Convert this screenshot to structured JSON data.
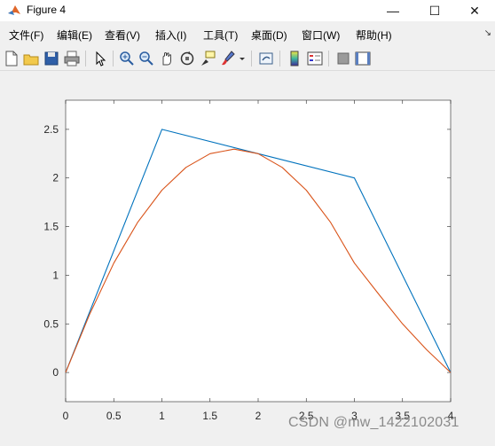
{
  "window": {
    "title": "Figure 4",
    "controls": {
      "minimize": "—",
      "maximize": "☐",
      "close": "✕"
    }
  },
  "menu": {
    "items": [
      "文件(F)",
      "编辑(E)",
      "查看(V)",
      "插入(I)",
      "工具(T)",
      "桌面(D)",
      "窗口(W)",
      "帮助(H)"
    ],
    "overflow_arrow": "↘"
  },
  "toolbar": {
    "buttons": [
      "new-figure-icon",
      "open-icon",
      "save-icon",
      "print-icon",
      "pointer-icon",
      "zoom-in-icon",
      "zoom-out-icon",
      "pan-icon",
      "rotate-3d-icon",
      "data-cursor-icon",
      "brush-icon",
      "brush-dropdown-icon",
      "link-plot-icon",
      "colorbar-icon",
      "legend-icon",
      "hide-plot-tools-icon",
      "show-plot-tools-icon"
    ]
  },
  "chart_data": {
    "type": "line",
    "xlim": [
      0,
      4
    ],
    "ylim": [
      -0.3,
      2.8
    ],
    "xticks": [
      "0",
      "0.5",
      "1",
      "1.5",
      "2",
      "2.5",
      "3",
      "3.5",
      "4"
    ],
    "yticks": [
      "0",
      "0.5",
      "1",
      "1.5",
      "2",
      "2.5"
    ],
    "grid": false,
    "series": [
      {
        "color": "#0072BD",
        "x": [
          0,
          1,
          2,
          3,
          4
        ],
        "y": [
          0,
          2.5,
          2.25,
          2.0,
          0
        ]
      },
      {
        "color": "#D95319",
        "x": [
          0,
          0.25,
          0.5,
          0.75,
          1,
          1.25,
          1.5,
          1.75,
          2,
          2.25,
          2.5,
          2.75,
          3,
          3.25,
          3.5,
          3.75,
          4
        ],
        "y": [
          0,
          0.6,
          1.125,
          1.547,
          1.875,
          2.109,
          2.25,
          2.297,
          2.25,
          2.109,
          1.875,
          1.547,
          1.125,
          0.809,
          0.5,
          0.234,
          0
        ]
      }
    ]
  },
  "watermark": "CSDN @mw_1422102031"
}
